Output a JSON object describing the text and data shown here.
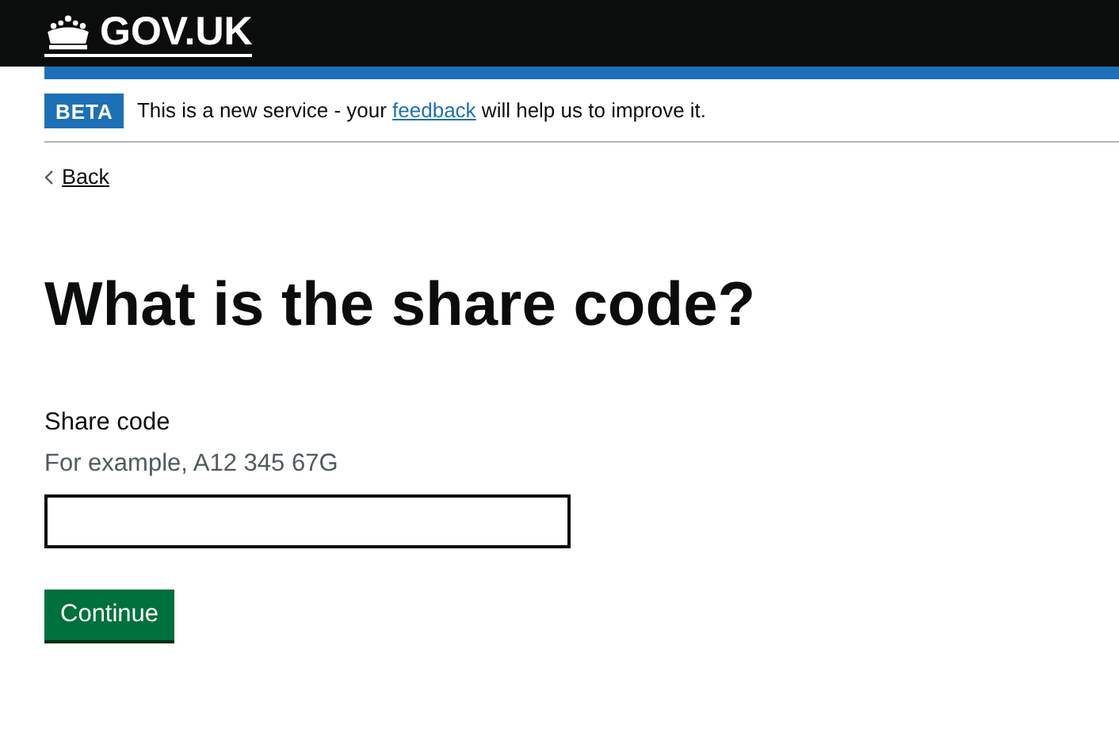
{
  "header": {
    "logo_text": "GOV.UK"
  },
  "phase_banner": {
    "tag": "BETA",
    "text_before": "This is a new service - your ",
    "link": "feedback",
    "text_after": " will help us to improve it."
  },
  "back_link": "Back",
  "heading": "What is the share code?",
  "field": {
    "label": "Share code",
    "hint": "For example, A12 345 67G"
  },
  "button": "Continue"
}
